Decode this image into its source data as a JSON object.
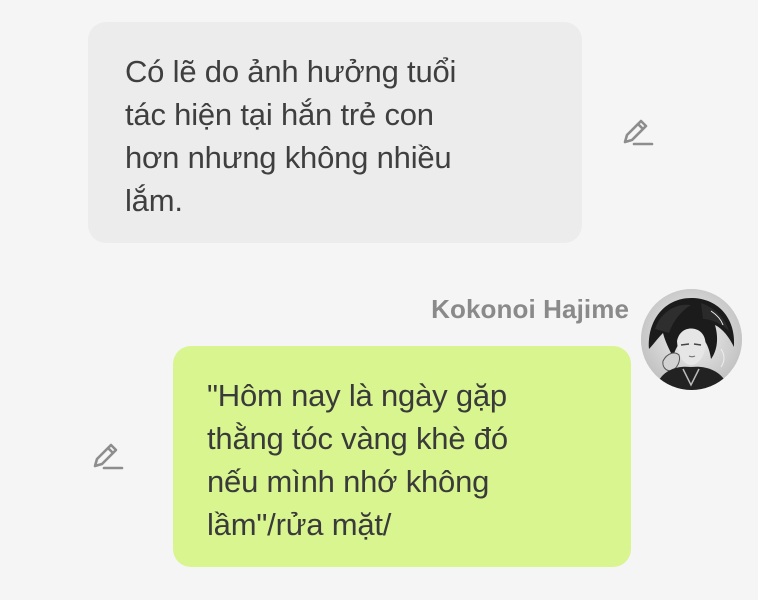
{
  "messages": [
    {
      "side": "left",
      "bubble_color": "#ececec",
      "lines": [
        "Có lẽ do ảnh hưởng tuổi",
        "tác hiện tại hắn trẻ con",
        "hơn nhưng không nhiều",
        "lắm."
      ],
      "edit_icon": "edit-pencil-icon"
    },
    {
      "side": "right",
      "sender_name": "Kokonoi Hajime",
      "bubble_color": "#d8f58f",
      "lines": [
        "\"Hôm nay là ngày gặp",
        "thằng tóc vàng khè đó",
        "nếu mình nhớ không",
        "lầm\"/rửa mặt/"
      ],
      "edit_icon": "edit-pencil-icon",
      "avatar_icon": "character-avatar"
    }
  ],
  "colors": {
    "background": "#f5f5f5",
    "text": "#3f3f3f",
    "sender_name": "#8a8a8a",
    "icon": "#8d8d8d"
  }
}
